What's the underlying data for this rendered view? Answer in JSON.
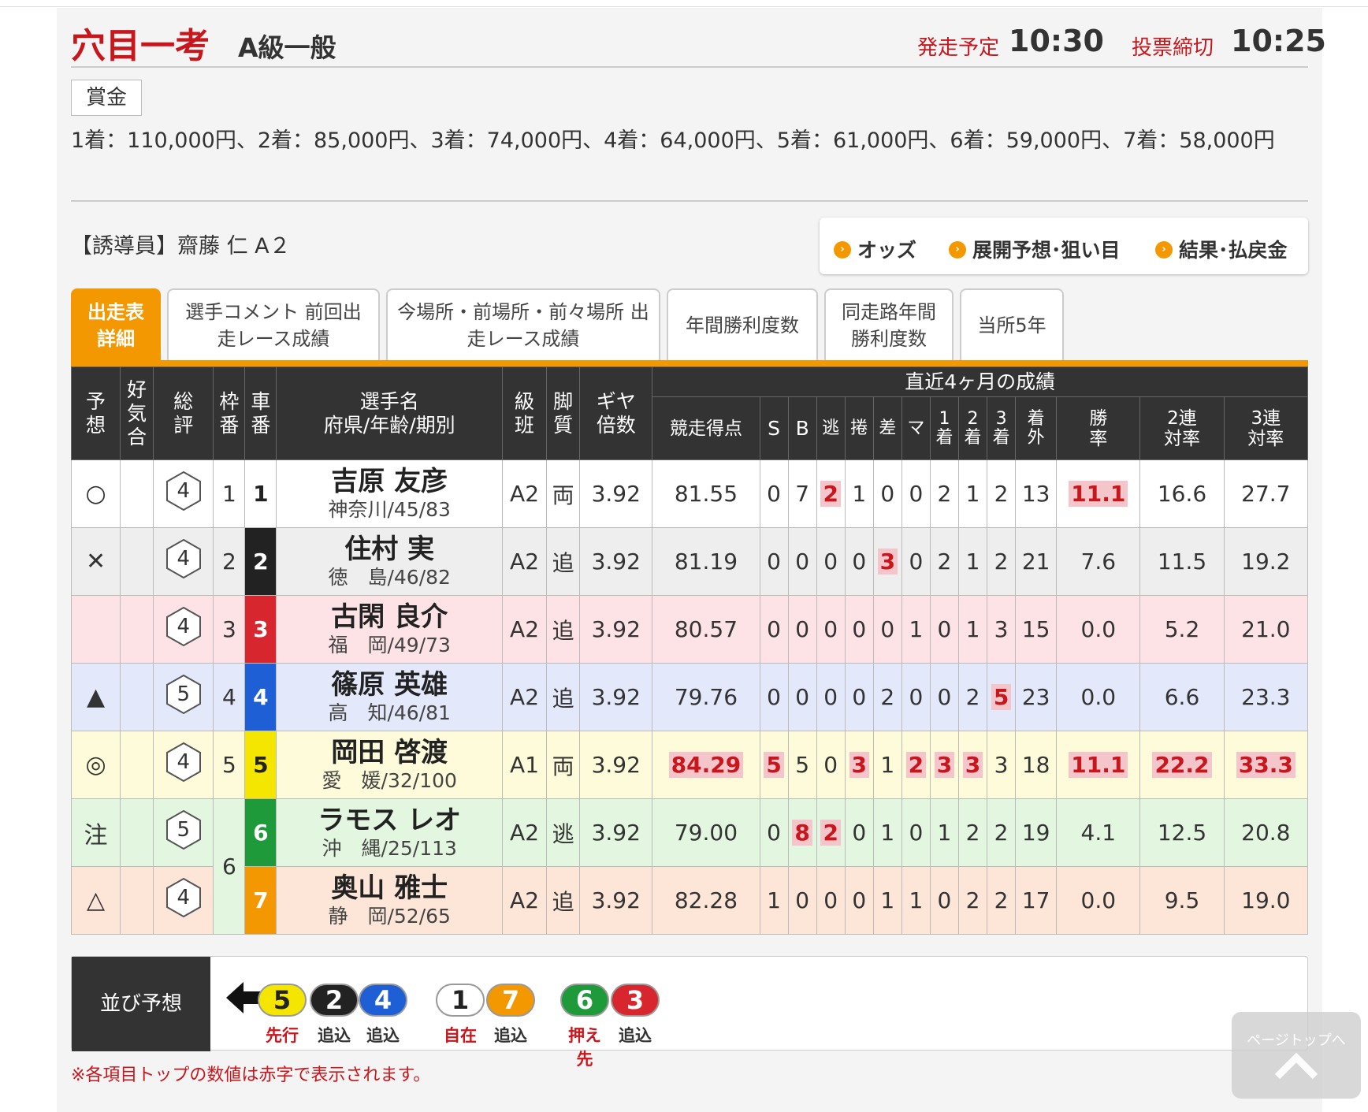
{
  "header": {
    "race_name": "穴目一考",
    "race_class": "A級一般",
    "start_label": "発走予定",
    "start_time": "10:30",
    "close_label": "投票締切",
    "close_time": "10:25"
  },
  "prize": {
    "label": "賞金",
    "text": "1着：110,000円、2着：85,000円、3着：74,000円、4着：64,000円、5着：61,000円、6着：59,000円、7着：58,000円"
  },
  "guide": "【誘導員】齋藤 仁 A２",
  "links": [
    {
      "label": "オッズ"
    },
    {
      "label": "展開予想･狙い目"
    },
    {
      "label": "結果･払戻金"
    }
  ],
  "tabs": [
    {
      "label": "出走表詳細"
    },
    {
      "label": "選手コメント 前回出走レース成績"
    },
    {
      "label": "今場所・前場所・前々場所 出走レース成績"
    },
    {
      "label": "年間勝利度数"
    },
    {
      "label": "同走路年間 勝利度数"
    },
    {
      "label": "当所5年"
    }
  ],
  "table": {
    "headers": {
      "yoso": "予想",
      "kibun": "好気合",
      "sohyo": "総評",
      "waku": "枠番",
      "sha": "車番",
      "name": "選手名",
      "name_sub": "府県/年齢/期別",
      "kyuhan": "級班",
      "kyakushitsu": "脚質",
      "gear": "ギヤ倍数",
      "recent": "直近4ヶ月の成績",
      "score": "競走得点",
      "s": "S",
      "b": "B",
      "nige": "逃",
      "makuri": "捲",
      "sashi": "差",
      "ma": "マ",
      "c1": "1着",
      "c2": "2着",
      "c3": "3着",
      "cout": "着外",
      "win": "勝率",
      "ren2": "2連対率",
      "ren3": "3連対率"
    },
    "rows": [
      {
        "mark": "○",
        "kibun": "",
        "hyo": "4",
        "waku": "1",
        "car": "1",
        "name": "吉原 友彦",
        "info": "神奈川/45/83",
        "cls": "A2",
        "kyaku": "両",
        "gear": "3.92",
        "score": "81.55",
        "s": "0",
        "b": "7",
        "nige": "2",
        "makuri": "1",
        "sashi": "0",
        "ma": "0",
        "c1": "2",
        "c2": "1",
        "c3": "2",
        "out": "13",
        "win": "11.1",
        "ren2": "16.6",
        "ren3": "27.7",
        "hl": [
          "nige",
          "win"
        ]
      },
      {
        "mark": "✕",
        "kibun": "",
        "hyo": "4",
        "waku": "2",
        "car": "2",
        "name": "住村 実",
        "info": "徳　島/46/82",
        "cls": "A2",
        "kyaku": "追",
        "gear": "3.92",
        "score": "81.19",
        "s": "0",
        "b": "0",
        "nige": "0",
        "makuri": "0",
        "sashi": "3",
        "ma": "0",
        "c1": "2",
        "c2": "1",
        "c3": "2",
        "out": "21",
        "win": "7.6",
        "ren2": "11.5",
        "ren3": "19.2",
        "hl": [
          "sashi"
        ]
      },
      {
        "mark": "",
        "kibun": "",
        "hyo": "4",
        "waku": "3",
        "car": "3",
        "name": "古閑 良介",
        "info": "福　岡/49/73",
        "cls": "A2",
        "kyaku": "追",
        "gear": "3.92",
        "score": "80.57",
        "s": "0",
        "b": "0",
        "nige": "0",
        "makuri": "0",
        "sashi": "0",
        "ma": "1",
        "c1": "0",
        "c2": "1",
        "c3": "3",
        "out": "15",
        "win": "0.0",
        "ren2": "5.2",
        "ren3": "21.0",
        "hl": []
      },
      {
        "mark": "▲",
        "kibun": "",
        "hyo": "5",
        "waku": "4",
        "car": "4",
        "name": "篠原 英雄",
        "info": "高　知/46/81",
        "cls": "A2",
        "kyaku": "追",
        "gear": "3.92",
        "score": "79.76",
        "s": "0",
        "b": "0",
        "nige": "0",
        "makuri": "0",
        "sashi": "2",
        "ma": "0",
        "c1": "0",
        "c2": "2",
        "c3": "5",
        "out": "23",
        "win": "0.0",
        "ren2": "6.6",
        "ren3": "23.3",
        "hl": [
          "c3"
        ]
      },
      {
        "mark": "◎",
        "kibun": "",
        "hyo": "4",
        "waku": "5",
        "car": "5",
        "name": "岡田 啓渡",
        "info": "愛　媛/32/100",
        "cls": "A1",
        "kyaku": "両",
        "gear": "3.92",
        "score": "84.29",
        "s": "5",
        "b": "5",
        "nige": "0",
        "makuri": "3",
        "sashi": "1",
        "ma": "2",
        "c1": "3",
        "c2": "3",
        "c3": "3",
        "out": "18",
        "win": "11.1",
        "ren2": "22.2",
        "ren3": "33.3",
        "hl": [
          "score",
          "s",
          "makuri",
          "ma",
          "c1",
          "c2",
          "win",
          "ren2",
          "ren3"
        ]
      },
      {
        "mark": "注",
        "kibun": "",
        "hyo": "5",
        "waku": "6",
        "car": "6",
        "name": "ラモス レオ",
        "info": "沖　縄/25/113",
        "cls": "A2",
        "kyaku": "逃",
        "gear": "3.92",
        "score": "79.00",
        "s": "0",
        "b": "8",
        "nige": "2",
        "makuri": "0",
        "sashi": "1",
        "ma": "0",
        "c1": "1",
        "c2": "2",
        "c3": "2",
        "out": "19",
        "win": "4.1",
        "ren2": "12.5",
        "ren3": "20.8",
        "hl": [
          "b",
          "nige"
        ]
      },
      {
        "mark": "△",
        "kibun": "",
        "hyo": "4",
        "waku": "",
        "car": "7",
        "name": "奥山 雅士",
        "info": "静　岡/52/65",
        "cls": "A2",
        "kyaku": "追",
        "gear": "3.92",
        "score": "82.28",
        "s": "1",
        "b": "0",
        "nige": "0",
        "makuri": "0",
        "sashi": "1",
        "ma": "1",
        "c1": "0",
        "c2": "2",
        "c3": "2",
        "out": "17",
        "win": "0.0",
        "ren2": "9.5",
        "ren3": "19.0",
        "hl": []
      }
    ]
  },
  "car_colors": {
    "1": {
      "bg": "#ffffff",
      "fg": "#222222"
    },
    "2": {
      "bg": "#222222",
      "fg": "#ffffff"
    },
    "3": {
      "bg": "#d7262e",
      "fg": "#ffffff"
    },
    "4": {
      "bg": "#1f5fd6",
      "fg": "#ffffff"
    },
    "5": {
      "bg": "#f5e600",
      "fg": "#222222"
    },
    "6": {
      "bg": "#1e9a3a",
      "fg": "#ffffff"
    },
    "7": {
      "bg": "#f39800",
      "fg": "#ffffff"
    }
  },
  "row_colors": [
    "#ffffff",
    "#eeeeee",
    "#fde3e5",
    "#e3e8fa",
    "#fdfbd9",
    "#e3f6e0",
    "#fde6d8"
  ],
  "narabi": {
    "label": "並び予想",
    "items": [
      {
        "car": "5",
        "type": "先行",
        "type_color": "#c8161d"
      },
      {
        "car": "2",
        "type": "追込",
        "type_color": "#333333"
      },
      {
        "car": "4",
        "type": "追込",
        "type_color": "#333333"
      },
      {
        "car": "1",
        "type": "自在",
        "type_color": "#c8161d"
      },
      {
        "car": "7",
        "type": "追込",
        "type_color": "#333333"
      },
      {
        "car": "6",
        "type": "押え先",
        "type_color": "#c8161d"
      },
      {
        "car": "3",
        "type": "追込",
        "type_color": "#333333"
      }
    ]
  },
  "note": "※各項目トップの数値は赤字で表示されます。",
  "pagetop": "ページトップへ",
  "colors": {
    "accent": "#f39800",
    "brand_red": "#c8161d",
    "highlight_bg": "#f4c6cb"
  }
}
